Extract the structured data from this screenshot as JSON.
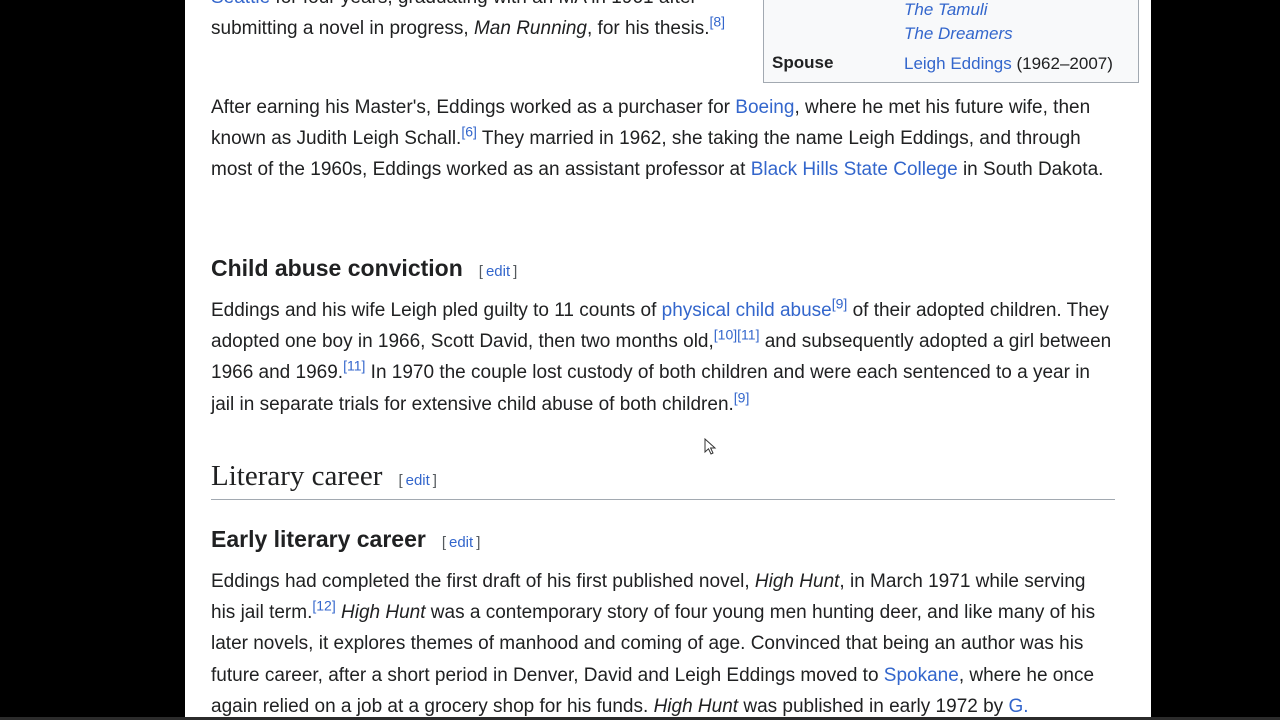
{
  "paragraphs": {
    "top": {
      "link_seattle": "Seattle",
      "t1": " for four years, graduating with an MA in 1961 after submitting a novel in progress, ",
      "em1": "Man Running",
      "t2": ", for his thesis.",
      "ref1": "[8]"
    },
    "boeing": {
      "t1": "After earning his Master's, Eddings worked as a purchaser for ",
      "link_boeing": "Boeing",
      "t2": ", where he met his future wife, then known as Judith Leigh Schall.",
      "ref1": "[6]",
      "t3": " They married in 1962, she taking the name Leigh Eddings, and through most of the 1960s, Eddings worked as an assistant professor at ",
      "link_bhsc": "Black Hills State College",
      "t4": " in South Dakota."
    },
    "abuse": {
      "t1": "Eddings and his wife Leigh pled guilty to 11 counts of ",
      "link_abuse": "physical child abuse",
      "ref1": "[9]",
      "t2": " of their adopted children. They adopted one boy in 1966, Scott David, then two months old,",
      "ref2": "[10]",
      "ref3": "[11]",
      "t3": " and subsequently adopted a girl between 1966 and 1969.",
      "ref4": "[11]",
      "t4": " In 1970 the couple lost custody of both children and were each sentenced to a year in jail in separate trials for extensive child abuse of both children.",
      "ref5": "[9]"
    },
    "early": {
      "t1": "Eddings had completed the first draft of his first published novel, ",
      "em1": "High Hunt",
      "t2": ", in March 1971 while serving his jail term.",
      "ref1": "[12]",
      "t3": " ",
      "em2": "High Hunt",
      "t4": " was a contemporary story of four young men hunting deer, and like many of his later novels, it explores themes of manhood and coming of age. Convinced that being an author was his future career, after a short period in Denver, David and Leigh Eddings moved to ",
      "link_spokane": "Spokane",
      "t5": ", where he once again relied on a job at a grocery shop for his funds. ",
      "em3": "High Hunt",
      "t6": " was published in early 1972 by ",
      "link_g": "G."
    }
  },
  "headings": {
    "child_abuse": "Child abuse conviction",
    "literary_career": "Literary career",
    "early_career": "Early literary career"
  },
  "edit": {
    "open": "[",
    "label": "edit",
    "close": "]"
  },
  "infobox": {
    "books": [
      "The Tamuli",
      "The Dreamers"
    ],
    "spouse_label": "Spouse",
    "spouse_link": "Leigh Eddings",
    "spouse_years": " (1962–2007)"
  },
  "colors": {
    "link": "#3366cc",
    "text": "#202122",
    "page_bg": "#ffffff",
    "outer_bg": "#000000"
  },
  "icons": {
    "cursor": "mouse-pointer-icon"
  }
}
